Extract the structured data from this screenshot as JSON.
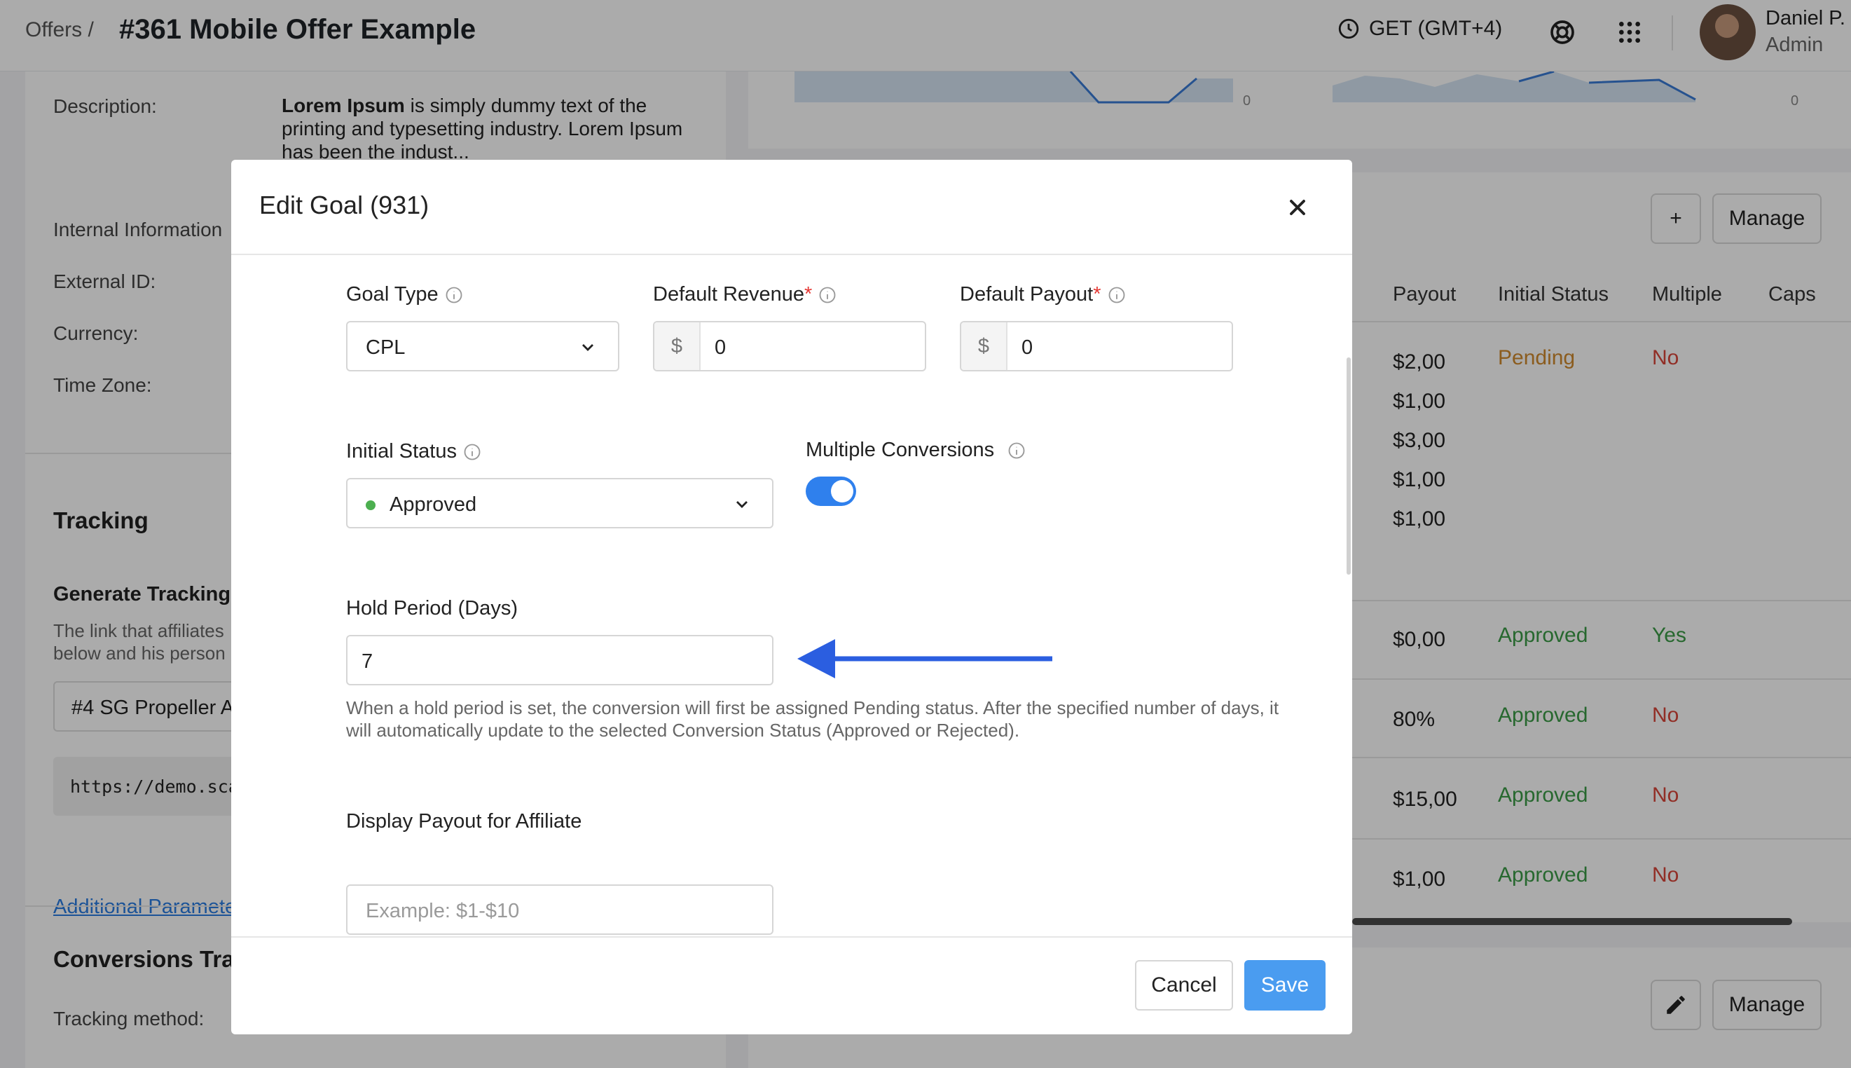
{
  "header": {
    "breadcrumb": "Offers /",
    "title": "#361 Mobile Offer Example",
    "timezone": "GET (GMT+4)",
    "user_name": "Daniel P.",
    "user_role": "Admin"
  },
  "left_panel": {
    "description_label": "Description:",
    "description_bold": "Lorem Ipsum",
    "description_rest": " is simply dummy text of the printing and typesetting industry. Lorem Ipsum has been the indust...",
    "internal_info_label": "Internal Information",
    "external_id_label": "External ID:",
    "currency_label": "Currency:",
    "timezone_label": "Time Zone:",
    "tracking_title": "Tracking",
    "generate_tracking": "Generate Tracking",
    "tracking_desc_1": "The link that affiliates",
    "tracking_desc_2": "below and his person",
    "tracking_select": "#4 SG Propeller A",
    "tracking_url": "https://demo.sca",
    "additional_params": "Additional Paramete",
    "conversions_title": "Conversions Tra",
    "tracking_method_label": "Tracking method:"
  },
  "right_panel": {
    "chart_zero_1": "0",
    "chart_zero_2": "0",
    "add_button": "+",
    "manage_button": "Manage",
    "manage_button_2": "Manage",
    "columns": [
      "Payout",
      "Initial Status",
      "Multiple",
      "Caps"
    ],
    "rows": [
      {
        "payout": "$2,00",
        "status": "Pending",
        "multiple": "No"
      },
      {
        "payout": "$1,00",
        "status": "",
        "multiple": ""
      },
      {
        "payout": "$3,00",
        "status": "",
        "multiple": ""
      },
      {
        "payout": "$1,00",
        "status": "",
        "multiple": ""
      },
      {
        "payout": "$1,00",
        "status": "",
        "multiple": ""
      },
      {
        "payout": "$0,00",
        "status": "Approved",
        "multiple": "Yes"
      },
      {
        "payout": "80%",
        "status": "Approved",
        "multiple": "No"
      },
      {
        "payout": "$15,00",
        "status": "Approved",
        "multiple": "No"
      },
      {
        "payout": "$1,00",
        "status": "Approved",
        "multiple": "No"
      }
    ],
    "colors": {
      "pending": "#d08a2e",
      "approved": "#3b9b46",
      "no": "#d9453a",
      "yes": "#3b9b46"
    }
  },
  "modal": {
    "title": "Edit Goal (931)",
    "goal_type_label": "Goal Type",
    "goal_type_value": "CPL",
    "default_revenue_label": "Default Revenue",
    "default_revenue_prefix": "$",
    "default_revenue_value": "0",
    "default_payout_label": "Default Payout",
    "default_payout_prefix": "$",
    "default_payout_value": "0",
    "required_mark": "*",
    "initial_status_label": "Initial Status",
    "initial_status_value": "Approved",
    "multiple_conversions_label": "Multiple Conversions",
    "multiple_conversions_on": true,
    "hold_period_label": "Hold Period (Days)",
    "hold_period_value": "7",
    "hold_period_help": "When a hold period is set, the conversion will first be assigned Pending status. After the specified number of days, it will automatically update to the selected Conversion Status (Approved or Rejected).",
    "display_payout_label": "Display Payout for Affiliate",
    "display_payout_placeholder": "Example: $1-$10",
    "cancel_button": "Cancel",
    "save_button": "Save",
    "accent_color": "#4a9cf0",
    "arrow_color": "#2b5ee0"
  }
}
